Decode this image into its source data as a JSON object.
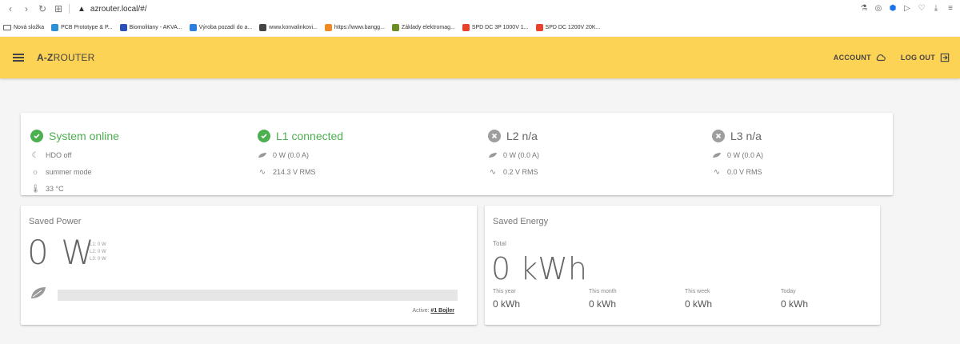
{
  "browser": {
    "url": "azrouter.local/#/",
    "bookmarks": [
      {
        "label": "Nová složka",
        "icon": "folder-icon",
        "color": "#666666"
      },
      {
        "label": "PCB Prototype & P...",
        "icon": "pcb-icon",
        "color": "#2d8fd6"
      },
      {
        "label": "Biomolitany - AKVA...",
        "icon": "biomolitany-icon",
        "color": "#2b4fb8"
      },
      {
        "label": "Výroba pozadí do a...",
        "icon": "check-icon",
        "color": "#2b7de0"
      },
      {
        "label": "www.konvalinkovi...",
        "icon": "page-icon",
        "color": "#444444"
      },
      {
        "label": "https://www.bangg...",
        "icon": "banggood-icon",
        "color": "#f08a24"
      },
      {
        "label": "Základy elektromag...",
        "icon": "leaf-icon",
        "color": "#6b8e23"
      },
      {
        "label": "SPD DC 3P 1000V 1...",
        "icon": "aliexpress-icon",
        "color": "#e8412c"
      },
      {
        "label": "SPD DC 1200V 20K...",
        "icon": "aliexpress-icon",
        "color": "#e8412c"
      }
    ]
  },
  "appbar": {
    "brand_bold": "A-Z",
    "brand_rest": "ROUTER",
    "account_label": "ACCOUNT",
    "logout_label": "LOG OUT",
    "color": "#fdd355"
  },
  "status": {
    "system": {
      "title": "System online",
      "hdo": "HDO off",
      "mode": "summer mode",
      "temp": "33 °C"
    },
    "phases": [
      {
        "title": "L1 connected",
        "power": "0 W (0.0 A)",
        "voltage": "214.3 V RMS",
        "state": "ok"
      },
      {
        "title": "L2 n/a",
        "power": "0 W (0.0 A)",
        "voltage": "0.2 V RMS",
        "state": "na"
      },
      {
        "title": "L3 n/a",
        "power": "0 W (0.0 A)",
        "voltage": "0.0 V RMS",
        "state": "na"
      }
    ]
  },
  "saved_power": {
    "title": "Saved Power",
    "value": "0 W",
    "phase_lines": [
      "L1: 0 W",
      "L2: 0 W",
      "L3: 0 W"
    ],
    "bar_fraction": 0,
    "active_label": "Active:",
    "active_device": "#1 Bojler"
  },
  "saved_energy": {
    "title": "Saved Energy",
    "total_label": "Total",
    "total_value": "0 kWh",
    "periods": [
      {
        "label": "This year",
        "value": "0 kWh"
      },
      {
        "label": "This month",
        "value": "0 kWh"
      },
      {
        "label": "This week",
        "value": "0 kWh"
      },
      {
        "label": "Today",
        "value": "0 kWh"
      }
    ]
  },
  "colors": {
    "ok": "#4caf50",
    "na": "#9e9e9e"
  }
}
